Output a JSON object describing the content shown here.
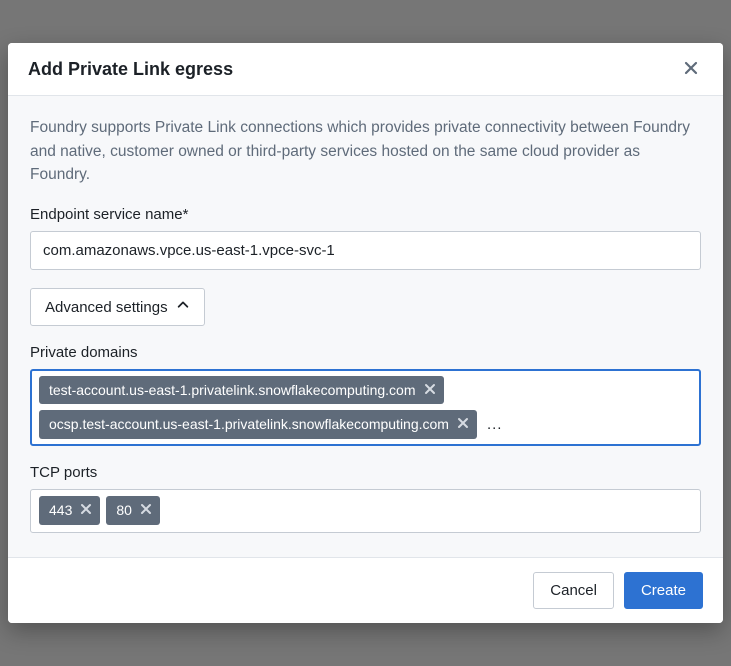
{
  "dialog": {
    "title": "Add Private Link egress",
    "intro": "Foundry supports Private Link connections which provides private connectivity between Foundry and native, customer owned or third-party services hosted on the same cloud provider as Foundry."
  },
  "endpoint": {
    "label": "Endpoint service name*",
    "value": "com.amazonaws.vpce.us-east-1.vpce-svc-1"
  },
  "advanced": {
    "label": "Advanced settings"
  },
  "privateDomains": {
    "label": "Private domains",
    "tags": [
      "test-account.us-east-1.privatelink.snowflakecomputing.com",
      "ocsp.test-account.us-east-1.privatelink.snowflakecomputing.com"
    ],
    "more": "..."
  },
  "tcpPorts": {
    "label": "TCP ports",
    "tags": [
      "443",
      "80"
    ]
  },
  "footer": {
    "cancel": "Cancel",
    "create": "Create"
  }
}
